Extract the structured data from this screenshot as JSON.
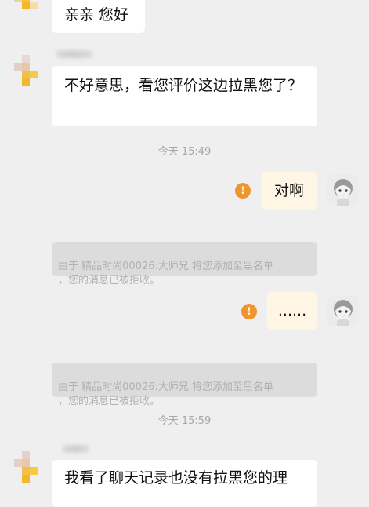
{
  "messages": {
    "m1": "亲亲 您好",
    "m2": "不好意思，看您评价这边拉黑您了？",
    "t1": "今天 15:49",
    "m3": "对啊",
    "sys1": "由于 精品时尚00026:大师兄 将您添加至黑名单\n，您的消息已被拒收。",
    "m4": "......",
    "sys2": "由于 精品时尚00026:大师兄 将您添加至黑名单\n，您的消息已被拒收。",
    "t2": "今天 15:59",
    "m5": "我看了聊天记录也没有拉黑您的理"
  },
  "icons": {
    "warning": "!"
  },
  "colors": {
    "background": "#efefef",
    "bubble_left": "#ffffff",
    "bubble_right": "#fff6e6",
    "warning": "#f0952c",
    "system_bg": "#dcdcdc",
    "system_text": "#b0b0b0",
    "time_text": "#a8a8a8"
  }
}
